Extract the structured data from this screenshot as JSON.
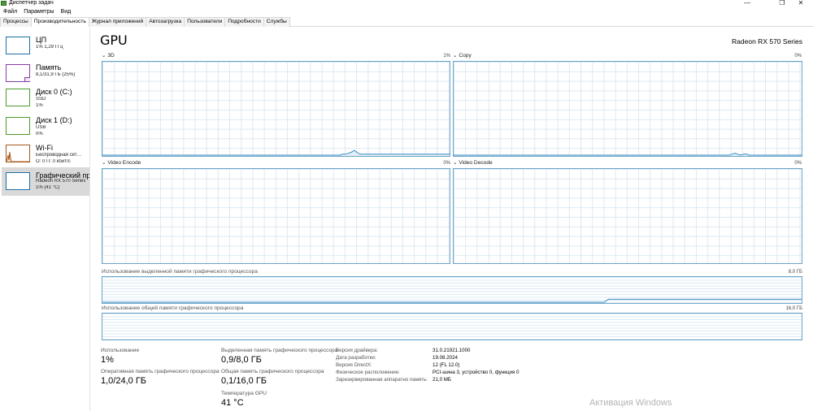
{
  "window": {
    "title": "Диспетчер задач",
    "minimize": "—",
    "maximize": "❐",
    "close": "✕"
  },
  "menu": [
    "Файл",
    "Параметры",
    "Вид"
  ],
  "tabs": [
    "Процессы",
    "Производительность",
    "Журнал приложений",
    "Автозагрузка",
    "Пользователи",
    "Подробности",
    "Службы"
  ],
  "active_tab": "Производительность",
  "sidebar": {
    "items": [
      {
        "title": "ЦП",
        "sub1": "1% 1,29 ГГц",
        "sub2": "",
        "color": "#1b6fa8"
      },
      {
        "title": "Память",
        "sub1": "8,1/31,9 ГБ (25%)",
        "sub2": "",
        "color": "#8b3aa8"
      },
      {
        "title": "Диск 0 (C:)",
        "sub1": "SSD",
        "sub2": "1%",
        "color": "#4e9a2a"
      },
      {
        "title": "Диск 1 (D:)",
        "sub1": "USB",
        "sub2": "0%",
        "color": "#4e9a2a"
      },
      {
        "title": "Wi-Fi",
        "sub1": "Беспроводная сет…",
        "sub2": "О: 0 П: 0 кбит/с",
        "color": "#a8591b"
      },
      {
        "title": "Графический процессор 0",
        "sub1": "Radeon RX 570 Series",
        "sub2": "1% (41 °C)",
        "color": "#1b6fa8"
      }
    ]
  },
  "main": {
    "title": "GPU",
    "model": "Radeon RX 570 Series",
    "engines": [
      {
        "name": "3D",
        "percent": "1%",
        "values": [
          0,
          0,
          0,
          0,
          0,
          0,
          0,
          0,
          0,
          0,
          0,
          0,
          0,
          0,
          0,
          0,
          0,
          0,
          0,
          0,
          0,
          0,
          0,
          0,
          0,
          0,
          0,
          0,
          0,
          0,
          0,
          0,
          0,
          0,
          0,
          0,
          0,
          0,
          0,
          0,
          0,
          0,
          0,
          0,
          0,
          0,
          0,
          0,
          0,
          0,
          0,
          0,
          0,
          0,
          0,
          0,
          0,
          0,
          0,
          0,
          0,
          0,
          0,
          0,
          0,
          0,
          0,
          0,
          0,
          0,
          0,
          0,
          0,
          0,
          0,
          0,
          0,
          0,
          0,
          0,
          0,
          0,
          0,
          1,
          1,
          2,
          3,
          5,
          3,
          1,
          1,
          1,
          1,
          1,
          1,
          1,
          1,
          1,
          1,
          1,
          1,
          1,
          1,
          1,
          1,
          1,
          1,
          1,
          1,
          1,
          1,
          1,
          1,
          1,
          1,
          1,
          1,
          1,
          1,
          1,
          1
        ]
      },
      {
        "name": "Copy",
        "percent": "0%",
        "values": [
          0,
          0,
          0,
          0,
          0,
          0,
          0,
          0,
          0,
          0,
          0,
          0,
          0,
          0,
          0,
          0,
          0,
          0,
          0,
          0,
          0,
          0,
          0,
          0,
          0,
          0,
          0,
          0,
          0,
          0,
          0,
          0,
          0,
          0,
          0,
          0,
          0,
          0,
          0,
          0,
          0,
          0,
          0,
          0,
          0,
          0,
          0,
          0,
          0,
          0,
          0,
          0,
          0,
          0,
          0,
          0,
          0,
          0,
          0,
          0,
          0,
          0,
          0,
          0,
          0,
          0,
          0,
          0,
          0,
          0,
          0,
          0,
          0,
          0,
          0,
          0,
          0,
          0,
          0,
          0,
          0,
          0,
          0,
          0,
          0,
          0,
          0,
          0,
          0,
          0,
          0,
          0,
          0,
          0,
          0,
          0,
          1,
          2,
          1,
          0,
          1,
          1,
          0,
          0,
          0,
          0,
          0,
          0,
          0,
          0,
          0,
          0,
          0,
          0,
          0,
          0,
          0,
          0,
          0,
          0,
          0
        ]
      },
      {
        "name": "Video Encode",
        "percent": "0%",
        "values": []
      },
      {
        "name": "Video Decode",
        "percent": "0%",
        "values": []
      }
    ],
    "dedicated_memory_chart": {
      "label": "Использование выделенной памяти графического процессора",
      "max": "8,0 ГБ",
      "values": [
        0,
        0,
        0,
        0,
        0,
        0,
        0,
        0,
        0,
        0,
        0,
        0,
        0,
        0,
        0,
        0,
        0,
        0,
        0,
        0,
        0,
        0,
        0,
        0,
        0,
        0,
        0,
        0,
        0,
        0,
        0,
        0,
        0,
        0,
        0,
        0,
        0,
        0,
        0,
        0,
        0,
        0,
        0,
        0,
        0,
        0,
        0,
        0,
        0,
        0,
        0,
        0,
        0,
        0,
        0,
        0,
        0,
        0,
        0,
        0,
        0,
        0,
        0,
        0,
        0,
        0,
        0,
        0,
        0,
        0,
        0,
        0,
        0,
        0,
        0,
        0,
        0,
        0,
        0,
        0,
        0,
        0,
        0,
        0,
        0,
        0,
        0,
        0,
        0,
        0,
        0,
        0,
        0,
        0,
        0,
        0,
        0,
        0,
        0,
        0,
        0,
        0,
        0,
        0,
        0,
        0,
        0,
        0,
        0,
        0,
        0,
        0,
        0,
        0,
        0,
        0,
        0,
        0,
        0.9,
        0.9,
        0.9,
        0.9,
        0.9,
        0.9,
        0.9,
        0.9,
        0.9,
        0.9,
        0.9,
        0.9,
        0.9,
        0.9,
        0.9,
        0.9,
        0.9,
        0.9,
        0.9,
        0.9,
        0.9,
        0.9,
        0.9,
        0.9,
        0.9,
        0.9,
        0.9,
        0.9,
        0.9,
        0.9,
        0.9,
        0.9,
        0.9,
        0.9,
        0.9,
        0.9,
        0.9,
        0.9,
        0.9,
        0.9,
        0.9,
        0.9,
        0.9,
        0.9,
        0.9,
        0.9
      ],
      "max_value": 8
    },
    "shared_memory_chart": {
      "label": "Использование общей памяти графического процессора",
      "max": "16,0 ГБ"
    },
    "stats": {
      "utilization_label": "Использование",
      "utilization_value": "1%",
      "dedicated_label": "Выделенная память графического процессора",
      "dedicated_value": "0,9/8,0 ГБ",
      "gpu_memory_label": "Оперативная память графического процессора",
      "gpu_memory_value": "1,0/24,0 ГБ",
      "shared_label": "Общая память графического процессора",
      "shared_value": "0,1/16,0 ГБ",
      "temp_label": "Температура GPU",
      "temp_value": "41 °C"
    },
    "properties": [
      {
        "label": "Версия драйвера:",
        "value": "31.0.21921.1000"
      },
      {
        "label": "Дата разработки:",
        "value": "19.08.2024"
      },
      {
        "label": "Версия DirectX:",
        "value": "12 (FL 12.0)"
      },
      {
        "label": "Физическое расположение:",
        "value": "PCI-шина 3, устройство 0, функция 0"
      },
      {
        "label": "Зарезервированная аппаратно память:",
        "value": "21,0 МБ"
      }
    ]
  },
  "watermark": "Активация Windows"
}
